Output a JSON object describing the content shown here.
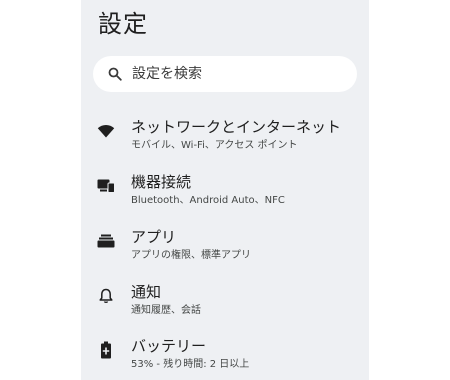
{
  "header": {
    "title": "設定"
  },
  "search": {
    "placeholder": "設定を検索",
    "icon": "search-icon"
  },
  "items": [
    {
      "title": "ネットワークとインターネット",
      "subtitle": "モバイル、Wi-Fi、アクセス ポイント",
      "icon": "wifi-icon"
    },
    {
      "title": "機器接続",
      "subtitle": "Bluetooth、Android Auto、NFC",
      "icon": "connected-devices-icon"
    },
    {
      "title": "アプリ",
      "subtitle": "アプリの権限、標準アプリ",
      "icon": "apps-icon"
    },
    {
      "title": "通知",
      "subtitle": "通知履歴、会話",
      "icon": "bell-icon"
    },
    {
      "title": "バッテリー",
      "subtitle": "53% - 残り時間: 2 日以上",
      "icon": "battery-icon"
    }
  ],
  "colors": {
    "screen_bg": "#eef0f3",
    "surface": "#ffffff",
    "text": "#1f1f1f",
    "subtext": "#444746"
  }
}
